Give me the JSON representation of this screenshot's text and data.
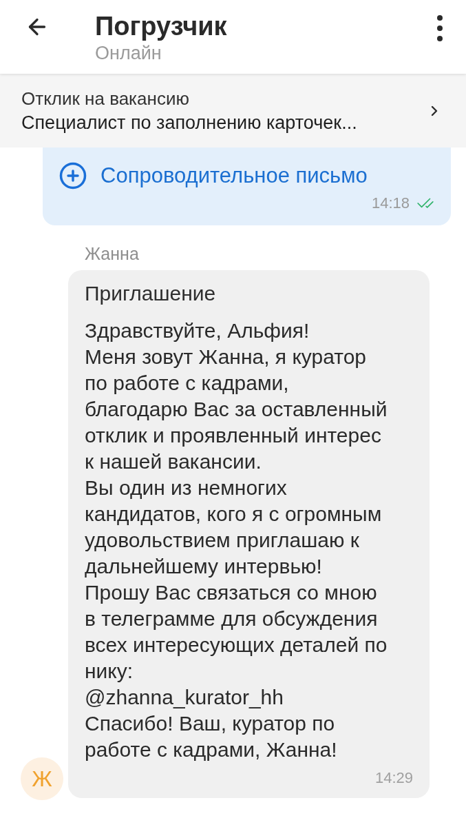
{
  "header": {
    "title": "Погрузчик",
    "status": "Онлайн"
  },
  "vacancy_banner": {
    "label": "Отклик на вакансию",
    "title": "Специалист по заполнению карточек..."
  },
  "messages": [
    {
      "kind": "outgoing",
      "attachment": "Сопроводительное письмо",
      "time": "14:18",
      "read": true
    },
    {
      "kind": "incoming",
      "sender": "Жанна",
      "avatar": "Ж",
      "title": "Приглашение",
      "body": "Здравствуйте, Альфия!\nМеня зовут Жанна, я куратор\nпо работе с кадрами,\nблагодарю Вас за оставленный\nотклик и проявленный интерес\nк нашей вакансии.\nВы один из немногих\nкандидатов, кого я с огромным\nудовольствием приглашаю к\nдальнейшему интервью!\nПрошу Вас связаться со мною\nв телеграмме для обсуждения\nвсех интересующих деталей по\nнику:\n@zhanna_kurator_hh\nСпасибо! Ваш, куратор по\nработе с кадрами, Жанна!",
      "time": "14:29"
    }
  ]
}
